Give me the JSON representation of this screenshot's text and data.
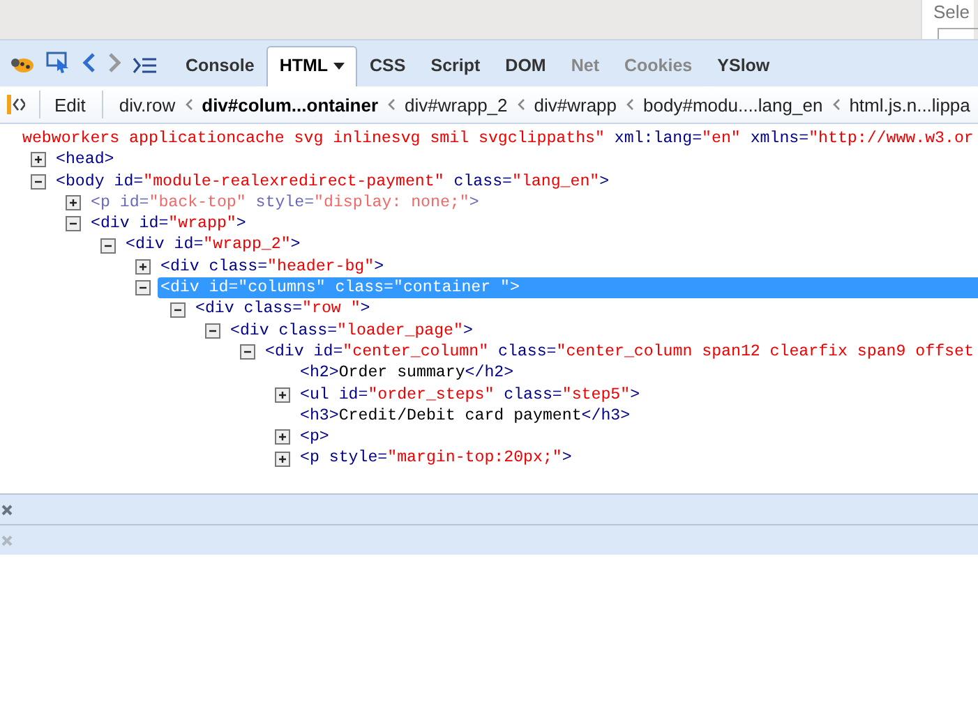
{
  "top_panel": {
    "label": "Sele"
  },
  "tabs": [
    {
      "label": "Console",
      "selected": false,
      "disabled": false,
      "dropdown": false
    },
    {
      "label": "HTML",
      "selected": true,
      "disabled": false,
      "dropdown": true
    },
    {
      "label": "CSS",
      "selected": false,
      "disabled": false,
      "dropdown": false
    },
    {
      "label": "Script",
      "selected": false,
      "disabled": false,
      "dropdown": false
    },
    {
      "label": "DOM",
      "selected": false,
      "disabled": false,
      "dropdown": false
    },
    {
      "label": "Net",
      "selected": false,
      "disabled": true,
      "dropdown": false
    },
    {
      "label": "Cookies",
      "selected": false,
      "disabled": true,
      "dropdown": false
    },
    {
      "label": "YSlow",
      "selected": false,
      "disabled": false,
      "dropdown": false
    }
  ],
  "edit_button": "Edit",
  "breadcrumbs": [
    {
      "label": "div.row",
      "selected": false
    },
    {
      "label": "div#colum...ontainer",
      "selected": true
    },
    {
      "label": "div#wrapp_2",
      "selected": false
    },
    {
      "label": "div#wrapp",
      "selected": false
    },
    {
      "label": "body#modu....lang_en",
      "selected": false
    },
    {
      "label": "html.js.n...lippa",
      "selected": false
    }
  ],
  "top_line": [
    {
      "kind": "value",
      "text": "webworkers applicationcache svg inlinesvg smil svgclippaths\""
    },
    {
      "kind": "attr",
      "text": " xml:lang="
    },
    {
      "kind": "value",
      "text": "\"en\""
    },
    {
      "kind": "attr",
      "text": " xmlns="
    },
    {
      "kind": "value",
      "text": "\"http://www.w3.or"
    }
  ],
  "tree": [
    {
      "hidden": false,
      "selected": false,
      "expanded": false,
      "tokens": [
        {
          "kind": "attr",
          "text": "<head>"
        }
      ]
    },
    {
      "hidden": false,
      "selected": false,
      "expanded": true,
      "tokens": [
        {
          "kind": "attr",
          "text": "<body id="
        },
        {
          "kind": "value",
          "text": "\"module-realexredirect-payment\""
        },
        {
          "kind": "attr",
          "text": " class="
        },
        {
          "kind": "value",
          "text": "\"lang_en\""
        },
        {
          "kind": "attr",
          "text": ">"
        }
      ],
      "children": [
        {
          "hidden": true,
          "selected": false,
          "expanded": false,
          "tokens": [
            {
              "kind": "attr",
              "text": "<p id="
            },
            {
              "kind": "value",
              "text": "\"back-top\""
            },
            {
              "kind": "attr",
              "text": " style="
            },
            {
              "kind": "value",
              "text": "\"display: none;\""
            },
            {
              "kind": "attr",
              "text": ">"
            }
          ]
        },
        {
          "hidden": false,
          "selected": false,
          "expanded": true,
          "tokens": [
            {
              "kind": "attr",
              "text": "<div id="
            },
            {
              "kind": "value",
              "text": "\"wrapp\""
            },
            {
              "kind": "attr",
              "text": ">"
            }
          ],
          "children": [
            {
              "hidden": false,
              "selected": false,
              "expanded": true,
              "tokens": [
                {
                  "kind": "attr",
                  "text": "<div id="
                },
                {
                  "kind": "value",
                  "text": "\"wrapp_2\""
                },
                {
                  "kind": "attr",
                  "text": ">"
                }
              ],
              "children": [
                {
                  "hidden": false,
                  "selected": false,
                  "expanded": false,
                  "tokens": [
                    {
                      "kind": "attr",
                      "text": "<div class="
                    },
                    {
                      "kind": "value",
                      "text": "\"header-bg\""
                    },
                    {
                      "kind": "attr",
                      "text": ">"
                    }
                  ]
                },
                {
                  "hidden": false,
                  "selected": true,
                  "expanded": true,
                  "tokens": [
                    {
                      "kind": "attr",
                      "text": "<div id="
                    },
                    {
                      "kind": "value",
                      "text": "\"columns\""
                    },
                    {
                      "kind": "attr",
                      "text": " class="
                    },
                    {
                      "kind": "value",
                      "text": "\"container \""
                    },
                    {
                      "kind": "attr",
                      "text": ">"
                    }
                  ],
                  "children": [
                    {
                      "hidden": false,
                      "selected": false,
                      "expanded": true,
                      "tokens": [
                        {
                          "kind": "attr",
                          "text": "<div class="
                        },
                        {
                          "kind": "value",
                          "text": "\"row \""
                        },
                        {
                          "kind": "attr",
                          "text": ">"
                        }
                      ],
                      "children": [
                        {
                          "hidden": false,
                          "selected": false,
                          "expanded": true,
                          "tokens": [
                            {
                              "kind": "attr",
                              "text": "<div class="
                            },
                            {
                              "kind": "value",
                              "text": "\"loader_page\""
                            },
                            {
                              "kind": "attr",
                              "text": ">"
                            }
                          ],
                          "children": [
                            {
                              "hidden": false,
                              "selected": false,
                              "expanded": true,
                              "tokens": [
                                {
                                  "kind": "attr",
                                  "text": "<div id="
                                },
                                {
                                  "kind": "value",
                                  "text": "\"center_column\""
                                },
                                {
                                  "kind": "attr",
                                  "text": " class="
                                },
                                {
                                  "kind": "value",
                                  "text": "\"center_column span12 clearfix span9 offset"
                                }
                              ],
                              "children": [
                                {
                                  "hidden": false,
                                  "selected": false,
                                  "tokens": [
                                    {
                                      "kind": "attr",
                                      "text": "<h2>"
                                    },
                                    {
                                      "kind": "text",
                                      "text": "Order summary"
                                    },
                                    {
                                      "kind": "attr",
                                      "text": "</h2>"
                                    }
                                  ]
                                },
                                {
                                  "hidden": false,
                                  "selected": false,
                                  "expanded": false,
                                  "tokens": [
                                    {
                                      "kind": "attr",
                                      "text": "<ul id="
                                    },
                                    {
                                      "kind": "value",
                                      "text": "\"order_steps\""
                                    },
                                    {
                                      "kind": "attr",
                                      "text": " class="
                                    },
                                    {
                                      "kind": "value",
                                      "text": "\"step5\""
                                    },
                                    {
                                      "kind": "attr",
                                      "text": ">"
                                    }
                                  ]
                                },
                                {
                                  "hidden": false,
                                  "selected": false,
                                  "tokens": [
                                    {
                                      "kind": "attr",
                                      "text": "<h3>"
                                    },
                                    {
                                      "kind": "text",
                                      "text": "Credit/Debit card payment"
                                    },
                                    {
                                      "kind": "attr",
                                      "text": "</h3>"
                                    }
                                  ]
                                },
                                {
                                  "hidden": false,
                                  "selected": false,
                                  "expanded": false,
                                  "tokens": [
                                    {
                                      "kind": "attr",
                                      "text": "<p>"
                                    }
                                  ]
                                },
                                {
                                  "hidden": false,
                                  "selected": false,
                                  "expanded": false,
                                  "tokens": [
                                    {
                                      "kind": "attr",
                                      "text": "<p style="
                                    },
                                    {
                                      "kind": "value",
                                      "text": "\"margin-top:20px;\""
                                    },
                                    {
                                      "kind": "attr",
                                      "text": ">"
                                    }
                                  ]
                                }
                              ]
                            }
                          ]
                        }
                      ]
                    }
                  ]
                }
              ]
            }
          ]
        }
      ]
    }
  ],
  "bars": [
    {
      "disabled": false
    },
    {
      "disabled": true
    }
  ]
}
